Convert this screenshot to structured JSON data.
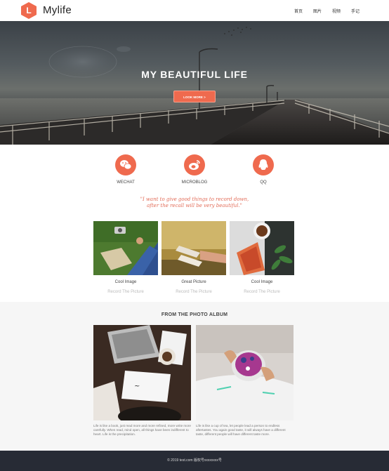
{
  "header": {
    "logo_letter": "L",
    "brand": "Mylife",
    "nav": [
      "首页",
      "图片",
      "视频",
      "手记"
    ]
  },
  "hero": {
    "title": "MY BEAUTIFUL LIFE",
    "button": "LOOK MORE >"
  },
  "social": [
    {
      "label": "WECHAT",
      "icon": "wechat-icon"
    },
    {
      "label": "MICROBLOG",
      "icon": "weibo-icon"
    },
    {
      "label": "QQ",
      "icon": "qq-icon"
    }
  ],
  "quote": {
    "line1": "\"I want to give good things to record down,",
    "line2": "after the recall will be very beautiful.\""
  },
  "photos": [
    {
      "title": "Cool Image",
      "subtitle": "Record The Picture"
    },
    {
      "title": "Great Picture",
      "subtitle": "Record The Picture"
    },
    {
      "title": "Cool Image",
      "subtitle": "Record The Picture"
    }
  ],
  "album": {
    "title": "FROM THE PHOTO ALBUM",
    "items": [
      {
        "text": "Life is like a book, just read more and more refined, more write more carefully. When read, mind open, all things have been indifferent to heart. Life is the precipitation."
      },
      {
        "text": "Life is like a cup of tea, let people lead a person to endless aftertastes. You again good taste, it will always have a different taste, different people will have different taste more."
      }
    ]
  },
  "footer": {
    "text": "© 2019 test.com 版权号xxxxxxxx号"
  },
  "colors": {
    "accent": "#ef6a4e",
    "footer_bg": "#272b35",
    "album_bg": "#f6f6f6"
  }
}
